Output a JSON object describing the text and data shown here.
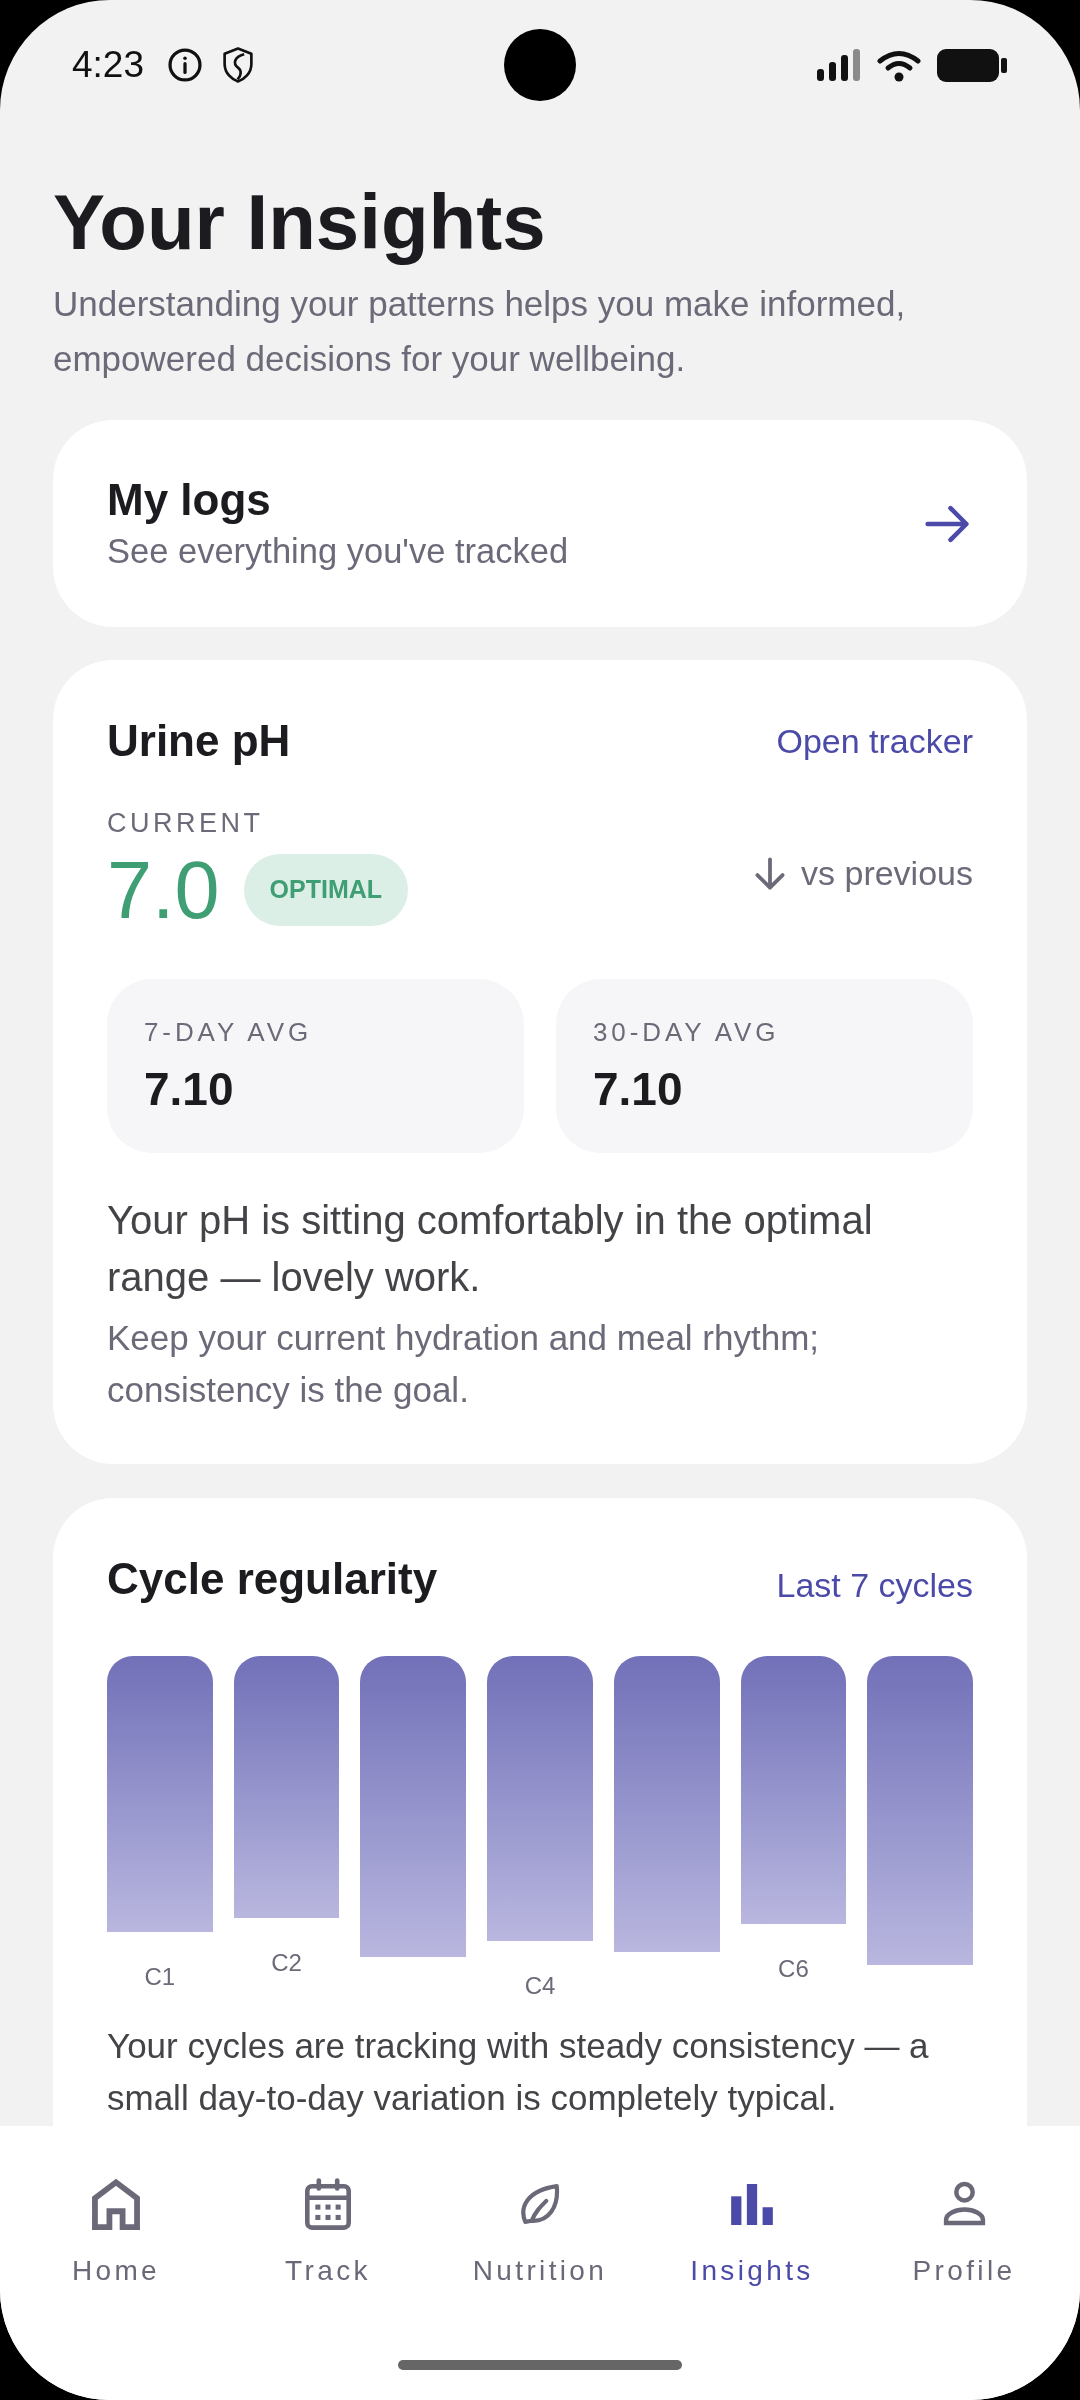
{
  "status_bar": {
    "time": "4:23"
  },
  "header": {
    "title": "Your Insights",
    "subtitle": "Understanding your patterns helps you make informed, empowered decisions for your wellbeing."
  },
  "logs_card": {
    "title": "My logs",
    "subtitle": "See everything you've tracked"
  },
  "ph_card": {
    "title": "Urine pH",
    "action": "Open tracker",
    "current_label": "CURRENT",
    "current_value": "7.0",
    "status": "OPTIMAL",
    "trend": {
      "falling": true,
      "label": "vs previous"
    },
    "averages": [
      {
        "label": "7-DAY AVG",
        "value": "7.10"
      },
      {
        "label": "30-DAY AVG",
        "value": "7.10"
      }
    ],
    "message": "Your pH is sitting comfortably in the optimal range — lovely work.",
    "tip": "Keep your current hydration and meal rhythm; consistency is the goal."
  },
  "cycle_card": {
    "title": "Cycle regularity",
    "range": "Last 7 cycles",
    "bar_labels": [
      "C1",
      "C2",
      "C4",
      "C6"
    ],
    "message": "Your cycles are tracking with steady consistency — a small day-to-day variation is completely typical."
  },
  "bottom_nav": [
    {
      "label": "Home",
      "selected": false
    },
    {
      "label": "Track",
      "selected": false
    },
    {
      "label": "Nutrition",
      "selected": false
    },
    {
      "label": "Insights",
      "selected": true
    },
    {
      "label": "Profile",
      "selected": false
    }
  ]
}
